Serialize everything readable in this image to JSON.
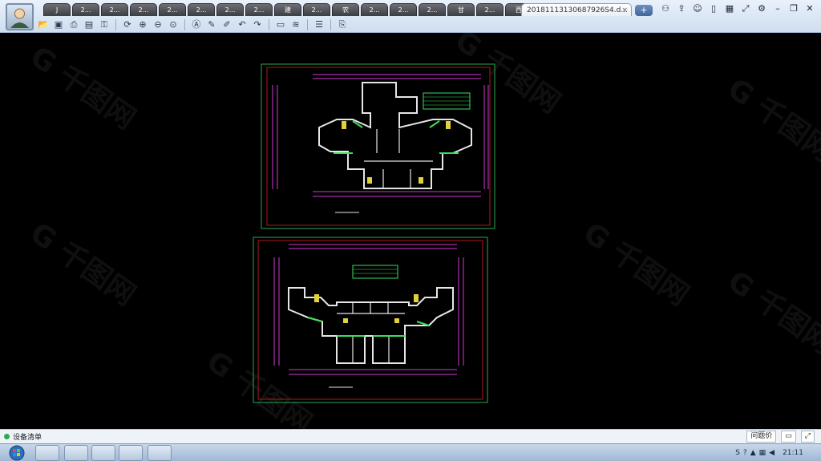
{
  "window": {
    "tabs": [
      {
        "label": "J"
      },
      {
        "label": "2..."
      },
      {
        "label": "2..."
      },
      {
        "label": "2..."
      },
      {
        "label": "2..."
      },
      {
        "label": "2..."
      },
      {
        "label": "2..."
      },
      {
        "label": "2..."
      },
      {
        "label": "建"
      },
      {
        "label": "2..."
      },
      {
        "label": "农"
      },
      {
        "label": "2..."
      },
      {
        "label": "2..."
      },
      {
        "label": "2..."
      },
      {
        "label": "甘"
      },
      {
        "label": "2..."
      },
      {
        "label": "西"
      }
    ],
    "active_tab": "20181113130687926S4.d...",
    "active_tab_close": "×",
    "add_tab": "+"
  },
  "toolbar": {
    "icons": [
      "open-icon",
      "save-icon",
      "print-icon",
      "pdf-icon",
      "lock-icon",
      "rotate-icon",
      "zoom-in-icon",
      "zoom-out-icon",
      "zoom-fit-icon",
      "text-icon",
      "pencil-icon",
      "markup-icon",
      "undo-icon",
      "redo-icon",
      "measure-icon",
      "dimension-icon",
      "layers-icon",
      "export-icon"
    ]
  },
  "watermark": {
    "text": "G 千图网"
  },
  "status": {
    "left_text": "设备清单",
    "right_button": "问题价",
    "comment_icon": "comment-icon"
  },
  "taskbar": {
    "clock": "21:11"
  },
  "colors": {
    "frame_green": "#28a84f",
    "frame_red": "#b01818",
    "wall_white": "#e6e6e6",
    "dim_magenta": "#d23ad2",
    "accent_green": "#39e05a",
    "accent_yellow": "#e2d23a"
  }
}
